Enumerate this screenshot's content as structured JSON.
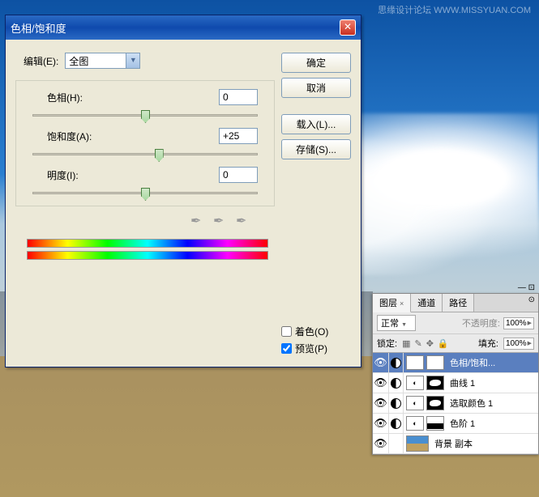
{
  "watermark": "思缘设计论坛  WWW.MISSYUAN.COM",
  "dialog": {
    "title": "色相/饱和度",
    "edit_label": "编辑(E):",
    "edit_value": "全图",
    "hue_label": "色相(H):",
    "hue_value": "0",
    "sat_label": "饱和度(A):",
    "sat_value": "+25",
    "light_label": "明度(I):",
    "light_value": "0",
    "colorize_label": "着色(O)",
    "preview_label": "预览(P)",
    "buttons": {
      "ok": "确定",
      "cancel": "取消",
      "load": "载入(L)...",
      "save": "存储(S)..."
    }
  },
  "panel": {
    "tabs": {
      "layers": "图层",
      "channels": "通道",
      "paths": "路径"
    },
    "blend_mode": "正常",
    "opacity_label": "不透明度:",
    "opacity_value": "100%",
    "lock_label": "锁定:",
    "fill_label": "填充:",
    "fill_value": "100%",
    "layers": [
      {
        "name": "色相/饱和..."
      },
      {
        "name": "曲线 1"
      },
      {
        "name": "选取颜色 1"
      },
      {
        "name": "色阶 1"
      },
      {
        "name": "背景 副本"
      }
    ]
  }
}
